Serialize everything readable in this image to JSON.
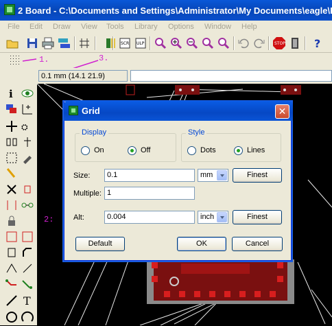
{
  "window": {
    "title": "2 Board - C:\\Documents and Settings\\Administrator\\My Documents\\eagle\\P"
  },
  "menu": [
    "File",
    "Edit",
    "Draw",
    "View",
    "Tools",
    "Library",
    "Options",
    "Window",
    "Help"
  ],
  "annotations": {
    "a1": "1.",
    "a2": "2:",
    "a3": "3."
  },
  "coordinates": {
    "text": "0.1 mm (14.1 21.9)"
  },
  "dialog": {
    "title": "Grid",
    "close_icon": "close-icon",
    "display": {
      "legend": "Display",
      "on_label": "On",
      "off_label": "Off",
      "selected": "Off"
    },
    "style": {
      "legend": "Style",
      "dots_label": "Dots",
      "lines_label": "Lines",
      "selected": "Lines"
    },
    "size": {
      "label": "Size:",
      "value": "0.1",
      "unit": "mm",
      "finest_label": "Finest"
    },
    "multiple": {
      "label": "Multiple:",
      "value": "1"
    },
    "alt": {
      "label": "Alt:",
      "value": "0.004",
      "unit": "inch",
      "finest_label": "Finest"
    },
    "buttons": {
      "default": "Default",
      "ok": "OK",
      "cancel": "Cancel"
    }
  },
  "colors": {
    "accent": "#0a58d8",
    "annotation": "#d020d0",
    "board": "#7a1010",
    "pad": "#d81e1e"
  }
}
